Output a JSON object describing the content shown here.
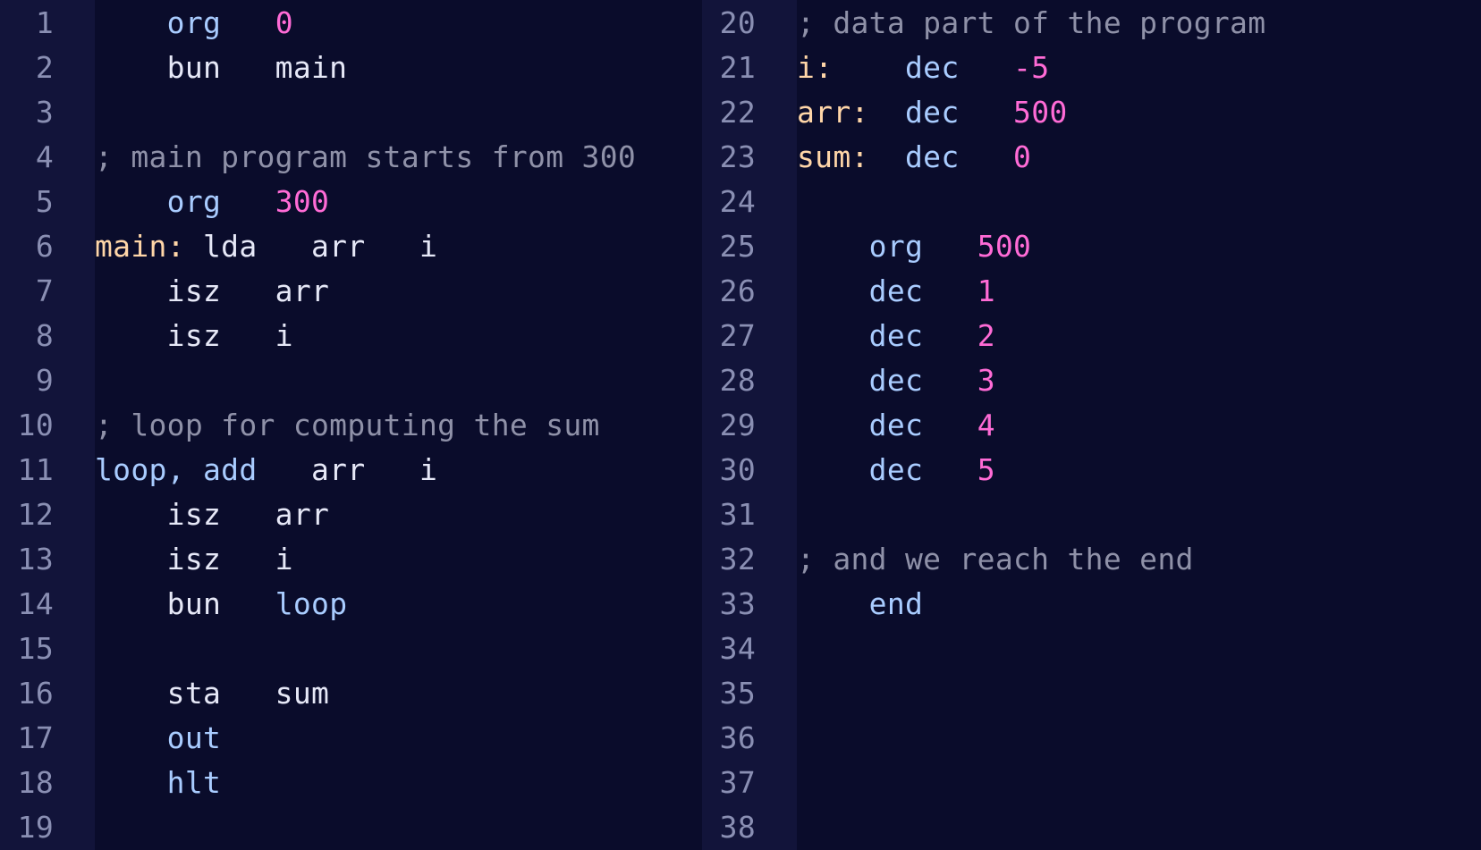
{
  "colors": {
    "background": "#0a0c2b",
    "gutter": "#12143a",
    "line_number": "#8a8fb3",
    "keyword": "#a9ccff",
    "number": "#ff6bd6",
    "label": "#ffd6a8",
    "comment": "#8f91a8",
    "text": "#e6e8f7"
  },
  "left_pane": {
    "lines": [
      {
        "n": "1",
        "tokens": [
          {
            "t": "    ",
            "k": "plain"
          },
          {
            "t": "org",
            "k": "kw"
          },
          {
            "t": "   ",
            "k": "plain"
          },
          {
            "t": "0",
            "k": "num"
          }
        ]
      },
      {
        "n": "2",
        "tokens": [
          {
            "t": "    bun   main",
            "k": "plain"
          }
        ]
      },
      {
        "n": "3",
        "tokens": []
      },
      {
        "n": "4",
        "tokens": [
          {
            "t": "; main program starts from 300",
            "k": "comment"
          }
        ]
      },
      {
        "n": "5",
        "tokens": [
          {
            "t": "    ",
            "k": "plain"
          },
          {
            "t": "org",
            "k": "kw"
          },
          {
            "t": "   ",
            "k": "plain"
          },
          {
            "t": "300",
            "k": "num"
          }
        ]
      },
      {
        "n": "6",
        "tokens": [
          {
            "t": "main:",
            "k": "label"
          },
          {
            "t": " lda   arr   i",
            "k": "plain"
          }
        ]
      },
      {
        "n": "7",
        "tokens": [
          {
            "t": "    isz   arr",
            "k": "plain"
          }
        ]
      },
      {
        "n": "8",
        "tokens": [
          {
            "t": "    isz   i",
            "k": "plain"
          }
        ]
      },
      {
        "n": "9",
        "tokens": []
      },
      {
        "n": "10",
        "tokens": [
          {
            "t": "; loop for computing the sum",
            "k": "comment"
          }
        ]
      },
      {
        "n": "11",
        "tokens": [
          {
            "t": "loop, add",
            "k": "kw"
          },
          {
            "t": "   arr   i",
            "k": "plain"
          }
        ]
      },
      {
        "n": "12",
        "tokens": [
          {
            "t": "    isz   arr",
            "k": "plain"
          }
        ]
      },
      {
        "n": "13",
        "tokens": [
          {
            "t": "    isz   i",
            "k": "plain"
          }
        ]
      },
      {
        "n": "14",
        "tokens": [
          {
            "t": "    bun   ",
            "k": "plain"
          },
          {
            "t": "loop",
            "k": "kw"
          }
        ]
      },
      {
        "n": "15",
        "tokens": []
      },
      {
        "n": "16",
        "tokens": [
          {
            "t": "    sta   sum",
            "k": "plain"
          }
        ]
      },
      {
        "n": "17",
        "tokens": [
          {
            "t": "    ",
            "k": "plain"
          },
          {
            "t": "out",
            "k": "kw"
          }
        ]
      },
      {
        "n": "18",
        "tokens": [
          {
            "t": "    ",
            "k": "plain"
          },
          {
            "t": "hlt",
            "k": "kw"
          }
        ]
      },
      {
        "n": "19",
        "tokens": []
      }
    ]
  },
  "right_pane": {
    "lines": [
      {
        "n": "20",
        "tokens": [
          {
            "t": "; data part of the program",
            "k": "comment"
          }
        ]
      },
      {
        "n": "21",
        "tokens": [
          {
            "t": "i:",
            "k": "label"
          },
          {
            "t": "    ",
            "k": "plain"
          },
          {
            "t": "dec",
            "k": "kw"
          },
          {
            "t": "   ",
            "k": "plain"
          },
          {
            "t": "-5",
            "k": "num"
          }
        ]
      },
      {
        "n": "22",
        "tokens": [
          {
            "t": "arr:",
            "k": "label"
          },
          {
            "t": "  ",
            "k": "plain"
          },
          {
            "t": "dec",
            "k": "kw"
          },
          {
            "t": "   ",
            "k": "plain"
          },
          {
            "t": "500",
            "k": "num"
          }
        ]
      },
      {
        "n": "23",
        "tokens": [
          {
            "t": "sum:",
            "k": "label"
          },
          {
            "t": "  ",
            "k": "plain"
          },
          {
            "t": "dec",
            "k": "kw"
          },
          {
            "t": "   ",
            "k": "plain"
          },
          {
            "t": "0",
            "k": "num"
          }
        ]
      },
      {
        "n": "24",
        "tokens": []
      },
      {
        "n": "25",
        "tokens": [
          {
            "t": "    ",
            "k": "plain"
          },
          {
            "t": "org",
            "k": "kw"
          },
          {
            "t": "   ",
            "k": "plain"
          },
          {
            "t": "500",
            "k": "num"
          }
        ]
      },
      {
        "n": "26",
        "tokens": [
          {
            "t": "    ",
            "k": "plain"
          },
          {
            "t": "dec",
            "k": "kw"
          },
          {
            "t": "   ",
            "k": "plain"
          },
          {
            "t": "1",
            "k": "num"
          }
        ]
      },
      {
        "n": "27",
        "tokens": [
          {
            "t": "    ",
            "k": "plain"
          },
          {
            "t": "dec",
            "k": "kw"
          },
          {
            "t": "   ",
            "k": "plain"
          },
          {
            "t": "2",
            "k": "num"
          }
        ]
      },
      {
        "n": "28",
        "tokens": [
          {
            "t": "    ",
            "k": "plain"
          },
          {
            "t": "dec",
            "k": "kw"
          },
          {
            "t": "   ",
            "k": "plain"
          },
          {
            "t": "3",
            "k": "num"
          }
        ]
      },
      {
        "n": "29",
        "tokens": [
          {
            "t": "    ",
            "k": "plain"
          },
          {
            "t": "dec",
            "k": "kw"
          },
          {
            "t": "   ",
            "k": "plain"
          },
          {
            "t": "4",
            "k": "num"
          }
        ]
      },
      {
        "n": "30",
        "tokens": [
          {
            "t": "    ",
            "k": "plain"
          },
          {
            "t": "dec",
            "k": "kw"
          },
          {
            "t": "   ",
            "k": "plain"
          },
          {
            "t": "5",
            "k": "num"
          }
        ]
      },
      {
        "n": "31",
        "tokens": []
      },
      {
        "n": "32",
        "tokens": [
          {
            "t": "; and we reach the end",
            "k": "comment"
          }
        ]
      },
      {
        "n": "33",
        "tokens": [
          {
            "t": "    ",
            "k": "plain"
          },
          {
            "t": "end",
            "k": "kw"
          }
        ]
      },
      {
        "n": "34",
        "tokens": []
      },
      {
        "n": "35",
        "tokens": []
      },
      {
        "n": "36",
        "tokens": []
      },
      {
        "n": "37",
        "tokens": []
      },
      {
        "n": "38",
        "tokens": []
      }
    ]
  }
}
